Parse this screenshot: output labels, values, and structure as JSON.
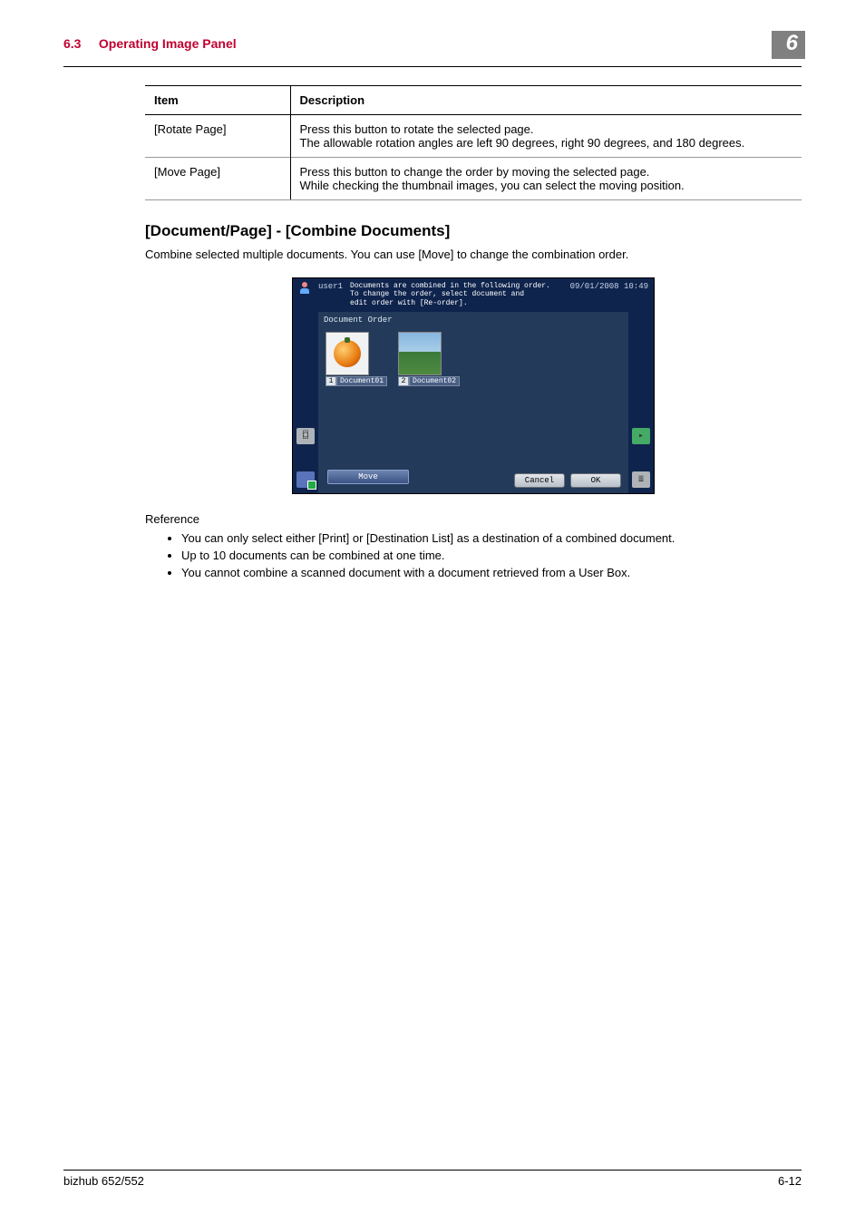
{
  "header": {
    "section_number": "6.3",
    "section_title": "Operating Image Panel",
    "chapter_badge": "6"
  },
  "table": {
    "columns": {
      "item": "Item",
      "desc": "Description"
    },
    "rows": [
      {
        "item": "[Rotate Page]",
        "desc": "Press this button to rotate the selected page.\nThe allowable rotation angles are left 90 degrees, right 90 degrees, and 180 degrees."
      },
      {
        "item": "[Move Page]",
        "desc": "Press this button to change the order by moving the selected page.\nWhile checking the thumbnail images, you can select the moving position."
      }
    ]
  },
  "subheading": "[Document/Page] - [Combine Documents]",
  "intro_para": "Combine selected multiple documents. You can use [Move] to change the combination order.",
  "panel": {
    "user": "user1",
    "datetime": "09/01/2008   10:49",
    "message": "Documents are combined in the following order.\nTo change the order, select document and\nedit order with [Re-order].",
    "doc_order_label": "Document Order",
    "thumbs": [
      {
        "num": "1",
        "name": "Document01"
      },
      {
        "num": "2",
        "name": "Document02"
      }
    ],
    "move_label": "Move",
    "cancel_label": "Cancel",
    "ok_label": "OK"
  },
  "reference": {
    "heading": "Reference",
    "bullets": [
      "You can only select either [Print] or [Destination List] as a destination of a combined document.",
      "Up to 10 documents can be combined at one time.",
      "You cannot combine a scanned document with a document retrieved from a User Box."
    ]
  },
  "footer": {
    "left": "bizhub 652/552",
    "right": "6-12"
  }
}
